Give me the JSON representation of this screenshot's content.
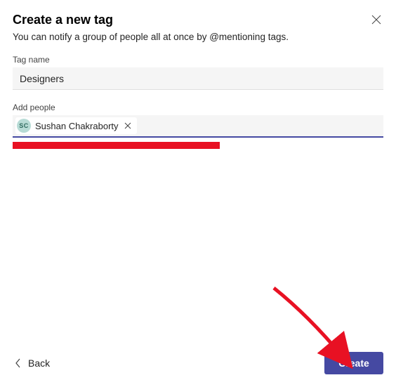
{
  "header": {
    "title": "Create a new tag",
    "subtitle": "You can notify a group of people all at once by @mentioning tags."
  },
  "fields": {
    "tag_name": {
      "label": "Tag name",
      "value": "Designers"
    },
    "add_people": {
      "label": "Add people",
      "people": [
        {
          "initials": "SC",
          "name": "Sushan Chakraborty"
        }
      ]
    }
  },
  "footer": {
    "back_label": "Back",
    "create_label": "Create"
  },
  "colors": {
    "accent": "#4549a2",
    "redaction": "#e81123",
    "avatar_bg": "#b7dbd5"
  }
}
